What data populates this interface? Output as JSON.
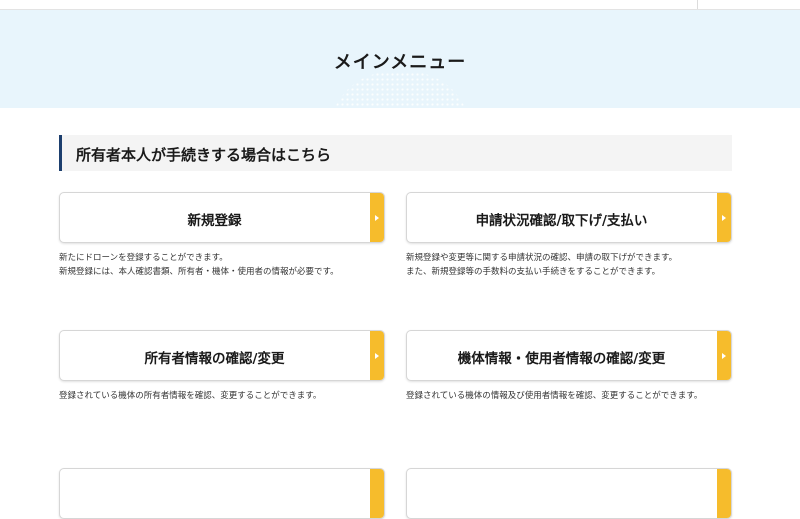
{
  "header": {
    "title": "メインメニュー"
  },
  "section": {
    "title": "所有者本人が手続きする場合はこちら"
  },
  "menu": [
    {
      "label": "新規登録",
      "desc": [
        "新たにドローンを登録することができます。",
        "新規登録には、本人確認書類、所有者・機体・使用者の情報が必要です。"
      ]
    },
    {
      "label": "申請状況確認/取下げ/支払い",
      "desc": [
        "新規登録や変更等に関する申請状況の確認、申請の取下げができます。",
        "また、新規登録等の手数料の支払い手続きをすることができます。"
      ]
    },
    {
      "label": "所有者情報の確認/変更",
      "desc": [
        "登録されている機体の所有者情報を確認、変更することができます。"
      ]
    },
    {
      "label": "機体情報・使用者情報の確認/変更",
      "desc": [
        "登録されている機体の情報及び使用者情報を確認、変更することができます。"
      ]
    }
  ],
  "theme": {
    "accent": "#f6bc2c",
    "hero_bg": "#e8f5fc",
    "section_bar": "#1d3f6e"
  }
}
